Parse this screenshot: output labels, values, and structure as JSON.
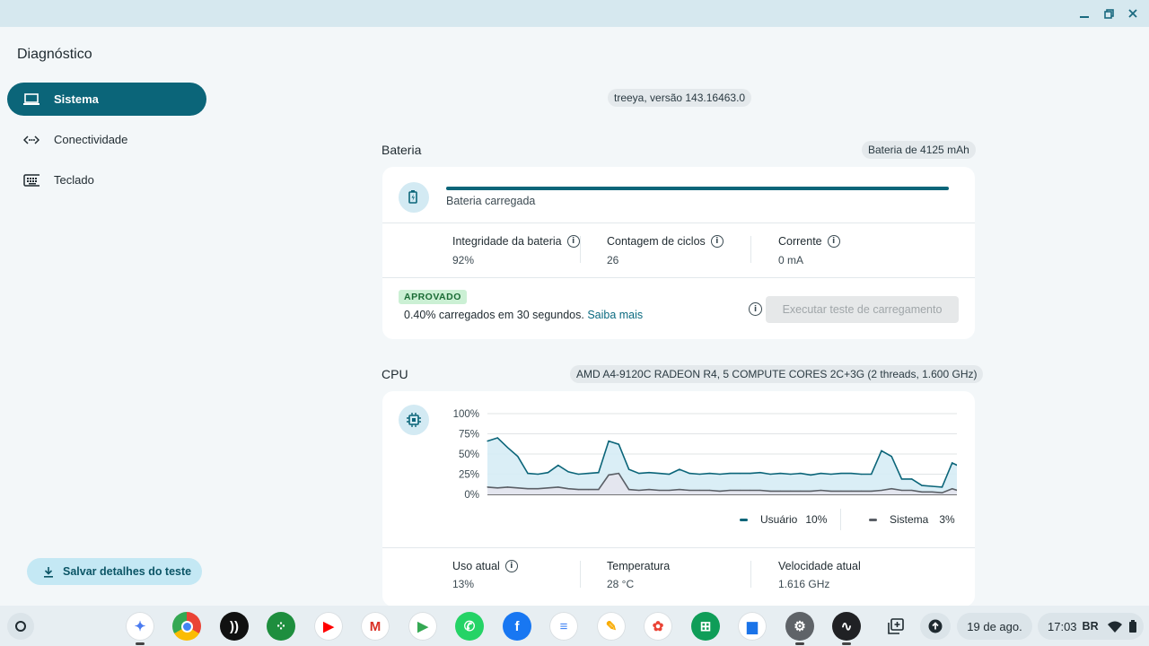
{
  "app": {
    "title": "Diagnóstico"
  },
  "sidebar": {
    "items": [
      {
        "label": "Sistema",
        "icon": "laptop-icon",
        "active": true
      },
      {
        "label": "Conectividade",
        "icon": "connectivity-icon",
        "active": false
      },
      {
        "label": "Teclado",
        "icon": "keyboard-icon",
        "active": false
      }
    ],
    "save_button": "Salvar detalhes do teste"
  },
  "version": "treeya, versão 143.16463.0",
  "battery": {
    "title": "Bateria",
    "capacity": "Bateria de 4125 mAh",
    "status": "Bateria carregada",
    "charge_level": 1.0,
    "stats": [
      {
        "label": "Integridade da bateria",
        "value": "92%",
        "info": true
      },
      {
        "label": "Contagem de ciclos",
        "value": "26",
        "info": true
      },
      {
        "label": "Corrente",
        "value": "0 mA",
        "info": true
      }
    ],
    "badge": "APROVADO",
    "result_text": "0.40% carregados em 30 segundos.",
    "learn_more": "Saiba mais",
    "run_button": "Executar teste de carregamento"
  },
  "cpu": {
    "title": "CPU",
    "model": "AMD A4-9120C RADEON R4, 5 COMPUTE CORES 2C+3G (2 threads, 1.600 GHz)",
    "legend": [
      {
        "label": "Usuário",
        "value": "10%"
      },
      {
        "label": "Sistema",
        "value": "3%"
      }
    ],
    "stats": [
      {
        "label": "Uso atual",
        "value": "13%",
        "info": true
      },
      {
        "label": "Temperatura",
        "value": "28 °C",
        "info": false
      },
      {
        "label": "Velocidade atual",
        "value": "1.616 GHz",
        "info": false
      }
    ]
  },
  "chart_data": {
    "type": "area",
    "y_ticks": [
      "100%",
      "75%",
      "50%",
      "25%",
      "0%"
    ],
    "ylim": [
      0,
      100
    ],
    "grid": true,
    "legend_position": "bottom-right",
    "series": [
      {
        "name": "Usuário",
        "color": "#0b6579",
        "values": [
          66,
          70,
          58,
          47,
          26,
          25,
          27,
          36,
          28,
          25,
          26,
          27,
          66,
          62,
          31,
          26,
          27,
          26,
          25,
          31,
          26,
          25,
          26,
          25,
          26,
          26,
          26,
          27,
          25,
          26,
          25,
          26,
          24,
          26,
          25,
          26,
          26,
          25,
          25,
          54,
          47,
          19,
          19,
          11,
          10,
          9,
          39,
          33
        ]
      },
      {
        "name": "Sistema",
        "color": "#5a5f66",
        "values": [
          9,
          8,
          9,
          8,
          7,
          7,
          8,
          9,
          7,
          6,
          6,
          6,
          24,
          26,
          6,
          5,
          6,
          5,
          5,
          6,
          5,
          5,
          5,
          4,
          5,
          5,
          5,
          5,
          4,
          4,
          4,
          4,
          4,
          5,
          4,
          4,
          4,
          4,
          4,
          5,
          7,
          5,
          5,
          3,
          3,
          2,
          7,
          3
        ]
      }
    ]
  },
  "taskbar": {
    "date": "19 de ago.",
    "time": "17:03",
    "locale": "BR",
    "apps": [
      {
        "name": "gemini-icon",
        "color": "#ffffff"
      },
      {
        "name": "chrome-icon",
        "color": "#ffffff"
      },
      {
        "name": "cast-icon",
        "color": "#111111"
      },
      {
        "name": "app-grid-icon",
        "color": "#1e8e3e"
      },
      {
        "name": "youtube-icon",
        "color": "#ffffff"
      },
      {
        "name": "gmail-icon",
        "color": "#ffffff"
      },
      {
        "name": "play-store-icon",
        "color": "#ffffff"
      },
      {
        "name": "whatsapp-icon",
        "color": "#25d366"
      },
      {
        "name": "facebook-icon",
        "color": "#1877f2"
      },
      {
        "name": "docs-icon",
        "color": "#ffffff"
      },
      {
        "name": "keep-icon",
        "color": "#ffffff"
      },
      {
        "name": "photos-icon",
        "color": "#ffffff"
      },
      {
        "name": "sheets-icon",
        "color": "#0f9d58"
      },
      {
        "name": "files-icon",
        "color": "#ffffff"
      },
      {
        "name": "settings-icon",
        "color": "#5f6368"
      },
      {
        "name": "diagnostics-icon",
        "color": "#202124"
      }
    ]
  }
}
